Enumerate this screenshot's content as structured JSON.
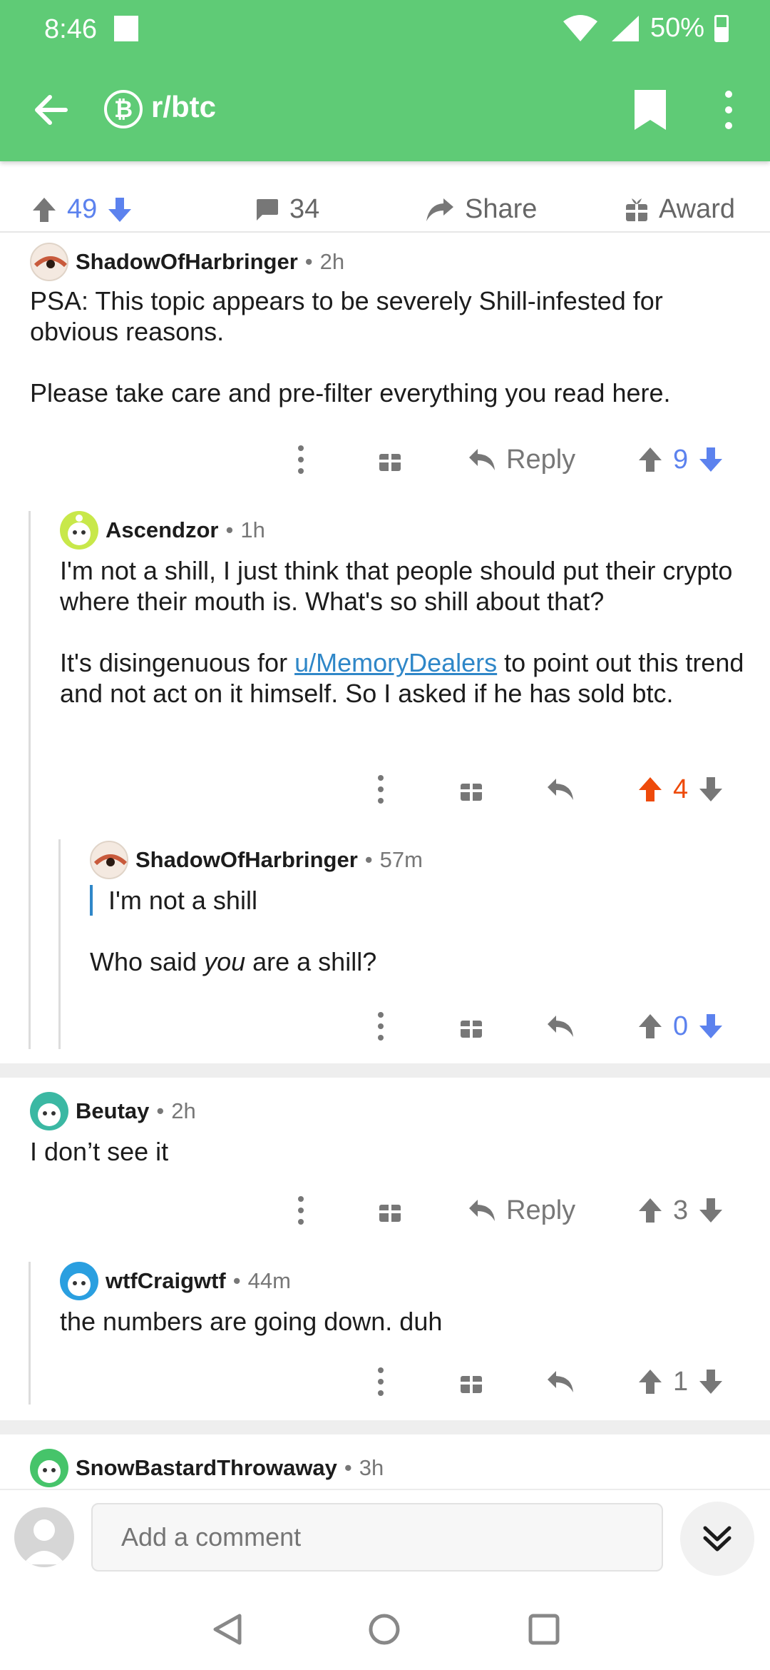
{
  "status": {
    "time": "8:46",
    "battery": "50%"
  },
  "app": {
    "subreddit": "r/btc",
    "sub_icon_glyph": "₿",
    "accent": "#5fcb76"
  },
  "post_actions": {
    "score": "49",
    "comments": "34",
    "share": "Share",
    "award": "Award"
  },
  "comments": [
    {
      "user": "ShadowOfHarbringer",
      "time": "2h",
      "prefix": "PSA:",
      "line1": " This topic appears to be severely Shill-infested for obvious reasons.",
      "line2": "Please take care and pre-filter everything you read here.",
      "reply": "Reply",
      "score": "9"
    },
    {
      "user": "Ascendzor",
      "time": "1h",
      "line1": "I'm not a shill, I just think that people should put their crypto where their mouth is. What's so shill about that?",
      "line2_pre": "It's disingenuous for ",
      "link": "u/MemoryDealers",
      "line2_post": " to point out this trend and not act on it himself. So I asked if he has sold btc.",
      "score": "4"
    },
    {
      "user": "ShadowOfHarbringer",
      "time": "57m",
      "quote": "I'm not a shill",
      "line_pre": "Who said ",
      "line_em": "you",
      "line_post": " are a shill?",
      "score": "0"
    },
    {
      "user": "Beutay",
      "time": "2h",
      "body": "I don’t see it",
      "reply": "Reply",
      "score": "3"
    },
    {
      "user": "wtfCraigwtf",
      "time": "44m",
      "body": "the numbers are going down. duh",
      "score": "1"
    },
    {
      "user": "SnowBastardThrowaway",
      "time": "3h"
    }
  ],
  "composer": {
    "placeholder": "Add a comment"
  }
}
